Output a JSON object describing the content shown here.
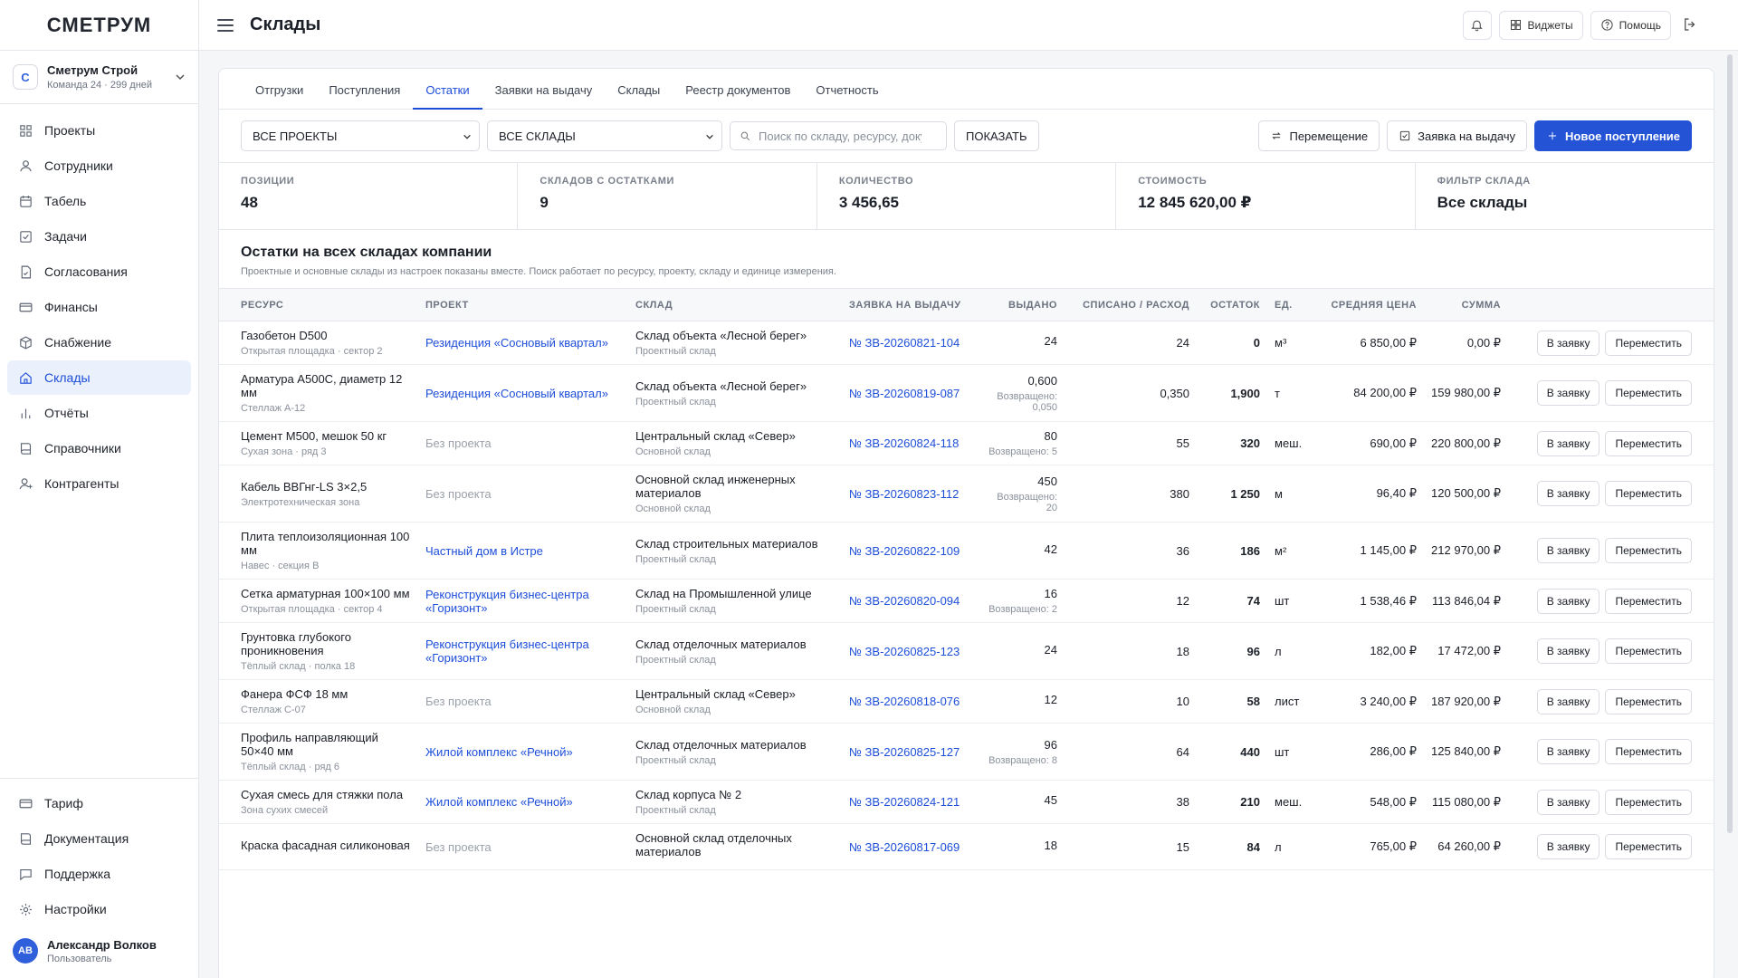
{
  "app": {
    "logo": "СМЕТРУМ",
    "page_title": "Склады"
  },
  "org": {
    "badge": "С",
    "name": "Сметрум Строй",
    "sub": "Команда 24 · 299 дней"
  },
  "nav": [
    {
      "label": "Проекты",
      "icon": "grid-icon"
    },
    {
      "label": "Сотрудники",
      "icon": "user-icon"
    },
    {
      "label": "Табель",
      "icon": "calendar-icon"
    },
    {
      "label": "Задачи",
      "icon": "checkbox-icon"
    },
    {
      "label": "Согласования",
      "icon": "doc-check-icon"
    },
    {
      "label": "Финансы",
      "icon": "card-icon"
    },
    {
      "label": "Снабжение",
      "icon": "box-icon"
    },
    {
      "label": "Склады",
      "icon": "home-icon"
    },
    {
      "label": "Отчёты",
      "icon": "bar-chart-icon"
    },
    {
      "label": "Справочники",
      "icon": "book-icon"
    },
    {
      "label": "Контрагенты",
      "icon": "user-plus-icon"
    }
  ],
  "nav_bottom": [
    {
      "label": "Тариф",
      "icon": "card-icon"
    },
    {
      "label": "Документация",
      "icon": "book-icon"
    },
    {
      "label": "Поддержка",
      "icon": "chat-icon"
    },
    {
      "label": "Настройки",
      "icon": "gear-icon"
    }
  ],
  "user": {
    "initials": "АВ",
    "name": "Александр Волков",
    "role": "Пользователь"
  },
  "topbar": {
    "widgets": "Виджеты",
    "help": "Помощь"
  },
  "tabs": [
    "Отгрузки",
    "Поступления",
    "Остатки",
    "Заявки на выдачу",
    "Склады",
    "Реестр документов",
    "Отчетность"
  ],
  "active_tab": 2,
  "filters": {
    "projects": "ВСЕ ПРОЕКТЫ",
    "warehouses": "ВСЕ СКЛАДЫ",
    "search_placeholder": "Поиск по складу, ресурсу, доку",
    "show": "ПОКАЗАТЬ",
    "move": "Перемещение",
    "request": "Заявка на выдачу",
    "new_receipt": "Новое поступление"
  },
  "stats": [
    {
      "label": "ПОЗИЦИИ",
      "value": "48"
    },
    {
      "label": "СКЛАДОВ С ОСТАТКАМИ",
      "value": "9"
    },
    {
      "label": "КОЛИЧЕСТВО",
      "value": "3 456,65"
    },
    {
      "label": "СТОИМОСТЬ",
      "value": "12 845 620,00 ₽"
    },
    {
      "label": "ФИЛЬТР СКЛАДА",
      "value": "Все склады"
    }
  ],
  "section": {
    "title": "Остатки на всех складах компании",
    "sub": "Проектные и основные склады из настроек показаны вместе. Поиск работает по ресурсу, проекту, складу и единице измерения."
  },
  "columns": [
    "РЕСУРС",
    "ПРОЕКТ",
    "СКЛАД",
    "ЗАЯВКА НА ВЫДАЧУ",
    "ВЫДАНО",
    "СПИСАНО / РАСХОД",
    "ОСТАТОК",
    "ЕД.",
    "СРЕДНЯЯ ЦЕНА",
    "СУММА",
    ""
  ],
  "row_actions": {
    "to_request": "В заявку",
    "move": "Переместить"
  },
  "rows": [
    {
      "res": "Газобетон D500",
      "loc": "Открытая площадка · сектор 2",
      "project": "Резиденция «Сосновый квартал»",
      "project_link": true,
      "wh": "Склад объекта «Лесной берег»",
      "wh_type": "Проектный склад",
      "req": "№ ЗВ-20260821-104",
      "issued": "24",
      "returned": "",
      "spent": "24",
      "rest": "0",
      "unit": "м³",
      "price": "6 850,00 ₽",
      "sum": "0,00 ₽"
    },
    {
      "res": "Арматура А500С, диаметр 12 мм",
      "loc": "Стеллаж А-12",
      "project": "Резиденция «Сосновый квартал»",
      "project_link": true,
      "wh": "Склад объекта «Лесной берег»",
      "wh_type": "Проектный склад",
      "req": "№ ЗВ-20260819-087",
      "issued": "0,600",
      "returned": "Возвращено: 0,050",
      "spent": "0,350",
      "rest": "1,900",
      "unit": "т",
      "price": "84 200,00 ₽",
      "sum": "159 980,00 ₽"
    },
    {
      "res": "Цемент М500, мешок 50 кг",
      "loc": "Сухая зона · ряд 3",
      "project": "Без проекта",
      "project_link": false,
      "wh": "Центральный склад «Север»",
      "wh_type": "Основной склад",
      "req": "№ ЗВ-20260824-118",
      "issued": "80",
      "returned": "Возвращено: 5",
      "spent": "55",
      "rest": "320",
      "unit": "меш.",
      "price": "690,00 ₽",
      "sum": "220 800,00 ₽"
    },
    {
      "res": "Кабель ВВГнг-LS 3×2,5",
      "loc": "Электротехническая зона",
      "project": "Без проекта",
      "project_link": false,
      "wh": "Основной склад инженерных материалов",
      "wh_type": "Основной склад",
      "req": "№ ЗВ-20260823-112",
      "issued": "450",
      "returned": "Возвращено: 20",
      "spent": "380",
      "rest": "1 250",
      "unit": "м",
      "price": "96,40 ₽",
      "sum": "120 500,00 ₽"
    },
    {
      "res": "Плита теплоизоляционная 100 мм",
      "loc": "Навес · секция В",
      "project": "Частный дом в Истре",
      "project_link": true,
      "wh": "Склад строительных материалов",
      "wh_type": "Проектный склад",
      "req": "№ ЗВ-20260822-109",
      "issued": "42",
      "returned": "",
      "spent": "36",
      "rest": "186",
      "unit": "м²",
      "price": "1 145,00 ₽",
      "sum": "212 970,00 ₽"
    },
    {
      "res": "Сетка арматурная 100×100 мм",
      "loc": "Открытая площадка · сектор 4",
      "project": "Реконструкция бизнес-центра «Горизонт»",
      "project_link": true,
      "wh": "Склад на Промышленной улице",
      "wh_type": "Проектный склад",
      "req": "№ ЗВ-20260820-094",
      "issued": "16",
      "returned": "Возвращено: 2",
      "spent": "12",
      "rest": "74",
      "unit": "шт",
      "price": "1 538,46 ₽",
      "sum": "113 846,04 ₽"
    },
    {
      "res": "Грунтовка глубокого проникновения",
      "loc": "Тёплый склад · полка 18",
      "project": "Реконструкция бизнес-центра «Горизонт»",
      "project_link": true,
      "wh": "Склад отделочных материалов",
      "wh_type": "Проектный склад",
      "req": "№ ЗВ-20260825-123",
      "issued": "24",
      "returned": "",
      "spent": "18",
      "rest": "96",
      "unit": "л",
      "price": "182,00 ₽",
      "sum": "17 472,00 ₽"
    },
    {
      "res": "Фанера ФСФ 18 мм",
      "loc": "Стеллаж С-07",
      "project": "Без проекта",
      "project_link": false,
      "wh": "Центральный склад «Север»",
      "wh_type": "Основной склад",
      "req": "№ ЗВ-20260818-076",
      "issued": "12",
      "returned": "",
      "spent": "10",
      "rest": "58",
      "unit": "лист",
      "price": "3 240,00 ₽",
      "sum": "187 920,00 ₽"
    },
    {
      "res": "Профиль направляющий 50×40 мм",
      "loc": "Тёплый склад · ряд 6",
      "project": "Жилой комплекс «Речной»",
      "project_link": true,
      "wh": "Склад отделочных материалов",
      "wh_type": "Проектный склад",
      "req": "№ ЗВ-20260825-127",
      "issued": "96",
      "returned": "Возвращено: 8",
      "spent": "64",
      "rest": "440",
      "unit": "шт",
      "price": "286,00 ₽",
      "sum": "125 840,00 ₽"
    },
    {
      "res": "Сухая смесь для стяжки пола",
      "loc": "Зона сухих смесей",
      "project": "Жилой комплекс «Речной»",
      "project_link": true,
      "wh": "Склад корпуса № 2",
      "wh_type": "Проектный склад",
      "req": "№ ЗВ-20260824-121",
      "issued": "45",
      "returned": "",
      "spent": "38",
      "rest": "210",
      "unit": "меш.",
      "price": "548,00 ₽",
      "sum": "115 080,00 ₽"
    },
    {
      "res": "Краска фасадная силиконовая",
      "loc": "",
      "project": "Без проекта",
      "project_link": false,
      "wh": "Основной склад отделочных материалов",
      "wh_type": "",
      "req": "№ ЗВ-20260817-069",
      "issued": "18",
      "returned": "",
      "spent": "15",
      "rest": "84",
      "unit": "л",
      "price": "765,00 ₽",
      "sum": "64 260,00 ₽"
    }
  ]
}
